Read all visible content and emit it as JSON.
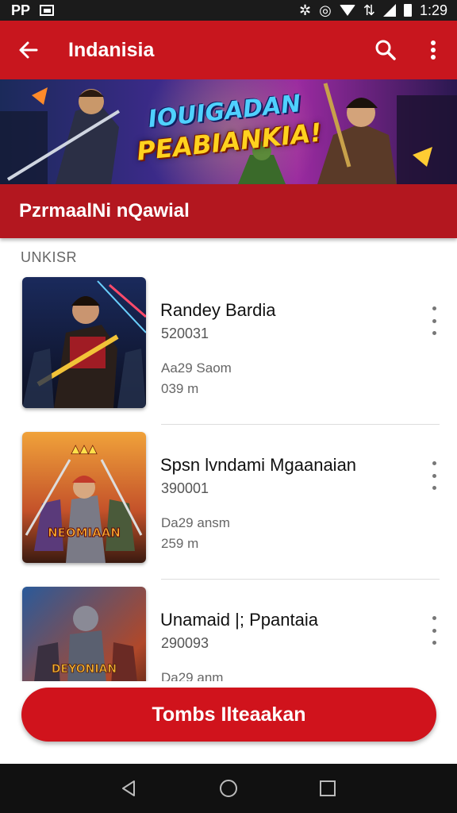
{
  "status_bar": {
    "left_text": "PP",
    "time": "1:29"
  },
  "app_bar": {
    "title": "Indanisia"
  },
  "banner": {
    "line1": "IOUIGADAN",
    "line2": "PEABIANKIA!"
  },
  "section": {
    "title": "PzrmaalNi nQawial"
  },
  "list_heading": "UNKISR",
  "items": [
    {
      "title": "Randey Bardia",
      "code": "520031",
      "subtitle": "Aa29 Saom",
      "distance": "039 m",
      "thumb_text": ""
    },
    {
      "title": "Spsn  lvndami Mgaanaian",
      "code": "390001",
      "subtitle": "Da29 ansm",
      "distance": "259 m",
      "thumb_text": "NEOMIAAN"
    },
    {
      "title": "Unamaid |; Ppantaia",
      "code": "290093",
      "subtitle": "Da29 anm",
      "distance": "",
      "thumb_text": "DEYONIAN"
    }
  ],
  "cta": {
    "label": "Tombs Ilteaakan"
  },
  "colors": {
    "primary": "#c8161e",
    "section": "#b3171f",
    "cta": "#d0131c"
  },
  "icons": [
    "back-arrow-icon",
    "search-icon",
    "more-vert-icon",
    "nav-back-icon",
    "nav-home-icon",
    "nav-recents-icon"
  ]
}
